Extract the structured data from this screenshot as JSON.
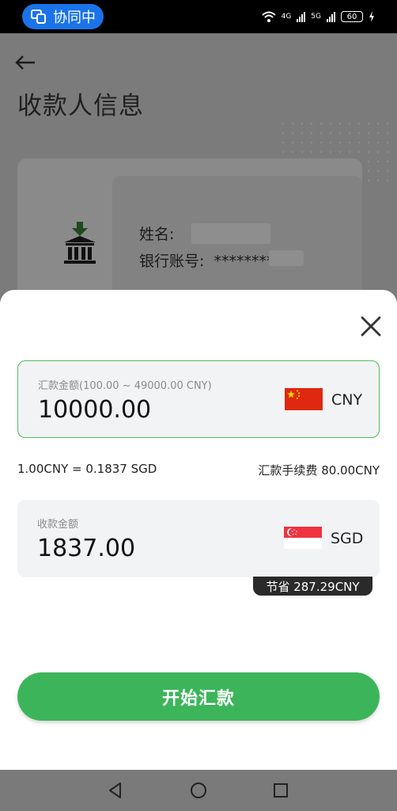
{
  "status_bar": {
    "collab_label": "协同中",
    "network_1": "4G",
    "network_2": "5G",
    "battery": "60"
  },
  "background_page": {
    "title": "收款人信息",
    "name_label": "姓名:",
    "account_label": "银行账号:",
    "account_value": "********"
  },
  "sheet": {
    "send_amount": {
      "label": "汇款金额(100.00 ~ 49000.00 CNY)",
      "value": "10000.00",
      "currency": "CNY",
      "flag": "china-flag-icon"
    },
    "rate_text": "1.00CNY = 0.1837 SGD",
    "fee_text": "汇款手续费 80.00CNY",
    "receive_amount": {
      "label": "收款金额",
      "value": "1837.00",
      "currency": "SGD",
      "flag": "singapore-flag-icon"
    },
    "savings_badge": "节省 287.29CNY",
    "cta_label": "开始汇款"
  },
  "colors": {
    "accent_green": "#3cb55a",
    "border_green": "#4cbf5a",
    "collab_blue": "#1a73e8"
  }
}
